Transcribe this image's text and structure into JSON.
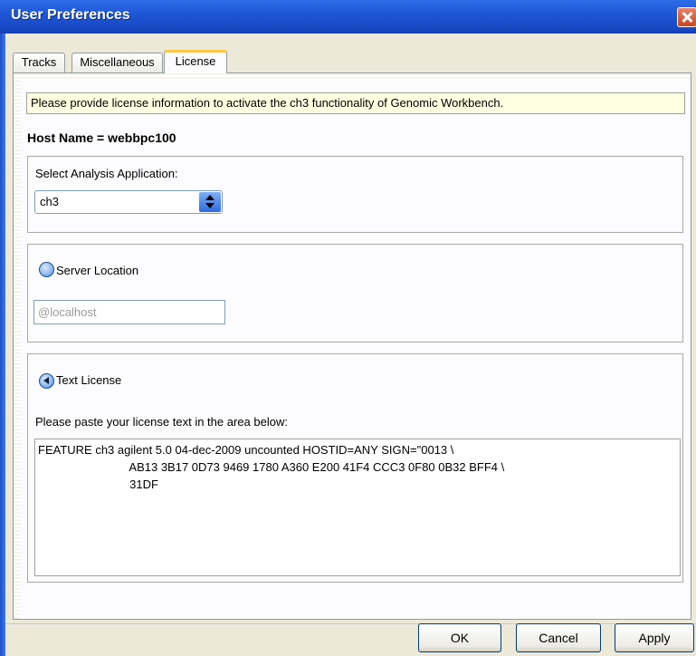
{
  "window": {
    "title": "User Preferences"
  },
  "tabs": [
    {
      "label": "Tracks",
      "active": false
    },
    {
      "label": "Miscellaneous",
      "active": false
    },
    {
      "label": "License",
      "active": true
    }
  ],
  "license": {
    "info_text": "Please provide license information to activate the ch3 functionality of Genomic Workbench.",
    "host_name": "Host Name = webbpc100",
    "select_label": "Select Analysis Application:",
    "selected_app": "ch3",
    "server_location_label": "Server Location",
    "server_location_selected": false,
    "server_location_value": "@localhost",
    "text_license_label": "Text License",
    "text_license_selected": true,
    "paste_instruction": "Please paste your license text in the area below:",
    "license_text": "FEATURE ch3 agilent 5.0 04-dec-2009 uncounted HOSTID=ANY SIGN=\"0013 \\\n\t\tAB13 3B17 0D73 9469 1780 A360 E200 41F4 CCC3 0F80 0B32 BFF4 \\\n\t\t31DF"
  },
  "buttons": {
    "ok": "OK",
    "cancel": "Cancel",
    "apply": "Apply"
  },
  "colors": {
    "title_bar": "#1f57d6",
    "info_background": "#ffffe1",
    "active_tab_accent": "#ffc83c",
    "close_button": "#c8451f"
  },
  "icons": {
    "close": "close-icon",
    "dropdown": "updown-arrow-icon",
    "radio": "radio-icon"
  }
}
